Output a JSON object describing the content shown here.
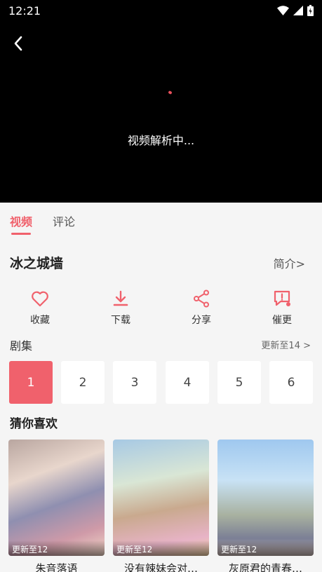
{
  "status": {
    "time": "12:21"
  },
  "player": {
    "parsing_text": "视频解析中..."
  },
  "tabs": [
    {
      "label": "视频"
    },
    {
      "label": "评论"
    }
  ],
  "show": {
    "title": "冰之城墙",
    "intro_label": "简介>"
  },
  "actions": [
    {
      "label": "收藏",
      "icon": "heart-icon"
    },
    {
      "label": "下载",
      "icon": "download-icon"
    },
    {
      "label": "分享",
      "icon": "share-icon"
    },
    {
      "label": "催更",
      "icon": "urge-update-icon"
    }
  ],
  "accent_color": "#f0616c",
  "episodes": {
    "section_title": "剧集",
    "update_label": "更新至14 >",
    "items": [
      "1",
      "2",
      "3",
      "4",
      "5",
      "6"
    ],
    "selected": "1"
  },
  "recommend": {
    "section_title": "猜你喜欢",
    "items": [
      {
        "update": "更新至12",
        "title": "朱音落语"
      },
      {
        "update": "更新至12",
        "title": "没有辣妹会对…"
      },
      {
        "update": "更新至12",
        "title": "灰原君的青春…"
      }
    ]
  }
}
